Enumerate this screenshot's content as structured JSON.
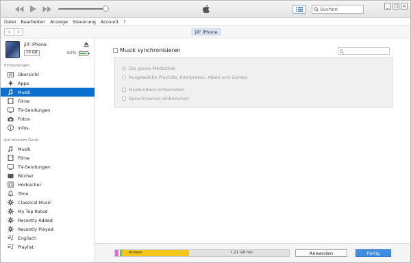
{
  "titlebar": {
    "search_placeholder": "Suchen",
    "window_controls": [
      "_",
      "□",
      "×"
    ]
  },
  "menu": [
    "Datei",
    "Bearbeiten",
    "Anzeige",
    "Steuerung",
    "Account",
    "?"
  ],
  "nav": {
    "device_pill": "jill' iPhone"
  },
  "device": {
    "name": "jill' iPhone",
    "capacity": "16 GB",
    "battery_pct": "92%",
    "battery_level": 0.92
  },
  "sidebar": {
    "settings_title": "Einstellungen",
    "settings_items": [
      {
        "label": "Übersicht",
        "icon": "summary-icon"
      },
      {
        "label": "Apps",
        "icon": "apps-icon"
      },
      {
        "label": "Musik",
        "icon": "music-note-icon",
        "selected": true
      },
      {
        "label": "Filme",
        "icon": "film-icon"
      },
      {
        "label": "TV-Sendungen",
        "icon": "tv-icon"
      },
      {
        "label": "Fotos",
        "icon": "camera-icon"
      },
      {
        "label": "Infos",
        "icon": "info-icon"
      }
    ],
    "device_title": "Auf meinem Gerät",
    "device_items": [
      {
        "label": "Musik",
        "icon": "music-note-icon"
      },
      {
        "label": "Filme",
        "icon": "film-icon"
      },
      {
        "label": "TV-Sendungen",
        "icon": "tv-icon"
      },
      {
        "label": "Bücher",
        "icon": "book-icon"
      },
      {
        "label": "Hörbücher",
        "icon": "audiobook-icon"
      },
      {
        "label": "Töne",
        "icon": "bell-icon"
      },
      {
        "label": "Classical Music",
        "icon": "gear-icon"
      },
      {
        "label": "My Top Rated",
        "icon": "gear-icon"
      },
      {
        "label": "Recently Added",
        "icon": "gear-icon"
      },
      {
        "label": "Recently Played",
        "icon": "gear-icon"
      },
      {
        "label": "Englisch",
        "icon": "playlist-icon"
      },
      {
        "label": "Playlist",
        "icon": "playlist-icon"
      }
    ]
  },
  "main": {
    "sync_label": "Musik synchronisieren",
    "options": [
      {
        "label": "Die ganze Mediathek",
        "type": "radio",
        "checked": true
      },
      {
        "label": "Ausgewählte Playlists, Interpreten, Alben und Genres",
        "type": "radio",
        "checked": false
      },
      {
        "label": "Musikvideos einbeziehen",
        "type": "checkbox",
        "checked": false
      },
      {
        "label": "Sprachmemos einbeziehen",
        "type": "checkbox",
        "checked": false
      }
    ]
  },
  "bottom": {
    "storage_other_label": "Andere",
    "storage_free_label": "7,21 GB frei",
    "colors": {
      "pink": "#e667d7",
      "green": "#5ccb5f",
      "yellow": "#f5c71a",
      "free": "#e2e2e2"
    },
    "apply_label": "Anwenden",
    "done_label": "Fertig"
  }
}
